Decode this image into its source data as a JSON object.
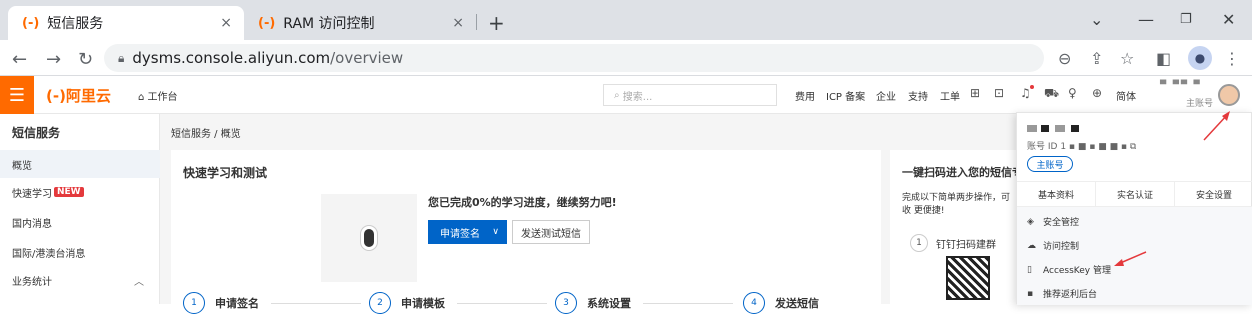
{
  "browser": {
    "tabs": [
      {
        "icon": "(-)",
        "label": "短信服务",
        "close": "×",
        "active": true
      },
      {
        "icon": "(-)",
        "label": "RAM 访问控制",
        "close": "×",
        "active": false
      }
    ],
    "new_tab": "+",
    "url_host": "dysms.console.aliyun.com",
    "url_path": "/overview"
  },
  "topnav": {
    "brand": "(-)阿里云",
    "workbench": "工作台",
    "search_placeholder": "搜索...",
    "links": [
      "费用",
      "ICP 备案",
      "企业",
      "支持",
      "工单"
    ],
    "lang": "简体",
    "account_sub": "主账号"
  },
  "sidebar": {
    "title": "短信服务",
    "items": [
      {
        "label": "概览",
        "active": true
      },
      {
        "label": "快速学习",
        "badge": "NEW"
      },
      {
        "label": "国内消息"
      },
      {
        "label": "国际/港澳台消息"
      },
      {
        "label": "业务统计"
      }
    ]
  },
  "main": {
    "breadcrumb": "短信服务 / 概览",
    "card1": {
      "title": "快速学习和测试",
      "progress": "您已完成0%的学习进度，继续努力吧!",
      "primary_btn": "申请签名",
      "secondary_btn": "发送测试短信",
      "steps": [
        {
          "num": "1",
          "label": "申请签名"
        },
        {
          "num": "2",
          "label": "申请模板"
        },
        {
          "num": "3",
          "label": "系统设置"
        },
        {
          "num": "4",
          "label": "发送短信"
        }
      ]
    },
    "card2": {
      "title": "一键扫码进入您的短信专",
      "desc": "完成以下简单两步操作，可收 更便捷!",
      "step_num": "1",
      "step_label": "钉钉扫码建群"
    }
  },
  "account_menu": {
    "id_label": "账号 ID",
    "id_prefix": "1",
    "badge": "主账号",
    "tabs": [
      "基本资料",
      "实名认证",
      "安全设置"
    ],
    "items": [
      "安全管控",
      "访问控制",
      "AccessKey 管理",
      "推荐返利后台"
    ]
  },
  "colors": {
    "brand": "#ff6a00",
    "primary": "#0064c8",
    "annotation": "#e4393c"
  }
}
